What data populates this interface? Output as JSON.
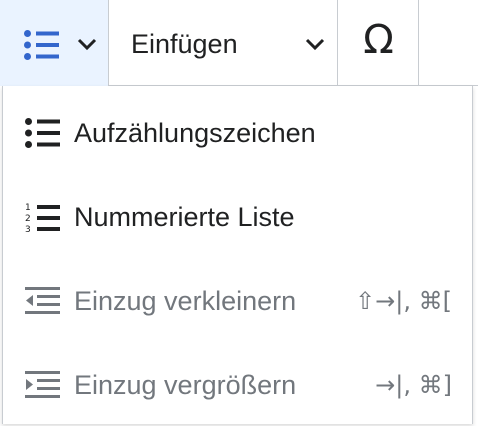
{
  "toolbar": {
    "list_button_icon": "bulleted-list-icon",
    "insert_label": "Einfügen",
    "special_char_label": "Ω",
    "accent_bg": "#eaf3ff",
    "accent_color": "#3366cc"
  },
  "menu": {
    "items": [
      {
        "label": "Aufzählungszeichen",
        "icon": "bulleted-list-icon",
        "shortcut": "",
        "disabled": false
      },
      {
        "label": "Nummerierte Liste",
        "icon": "numbered-list-icon",
        "shortcut": "",
        "disabled": false
      },
      {
        "label": "Einzug verkleinern",
        "icon": "outdent-icon",
        "shortcut": "⇧→|, ⌘[",
        "disabled": true
      },
      {
        "label": "Einzug vergrößern",
        "icon": "indent-icon",
        "shortcut": "→|, ⌘]",
        "disabled": true
      }
    ],
    "disabled_color": "#72777d"
  }
}
